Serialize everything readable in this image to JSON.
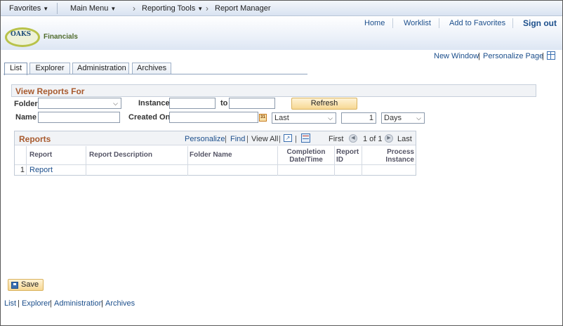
{
  "nav": {
    "favorites": "Favorites",
    "main_menu": "Main Menu",
    "reporting_tools": "Reporting Tools",
    "report_manager": "Report Manager"
  },
  "header": {
    "logo_text": "OAKS",
    "logo_sub": "Financials",
    "home": "Home",
    "worklist": "Worklist",
    "add_to_favorites": "Add to Favorites",
    "sign_out": "Sign out"
  },
  "page_links": {
    "new_window": "New Window",
    "personalize_page": "Personalize Page"
  },
  "tabs": [
    "List",
    "Explorer",
    "Administration",
    "Archives"
  ],
  "filters": {
    "section_title": "View Reports For",
    "folder_label": "Folder",
    "folder_value": "",
    "instance_label": "Instance",
    "instance_from": "",
    "to_label": "to",
    "instance_to": "",
    "refresh_label": "Refresh",
    "name_label": "Name",
    "name_value": "",
    "created_on_label": "Created On",
    "created_on_value": "",
    "calendar_glyph": "31",
    "period_value": "Last",
    "count_value": "1",
    "unit_value": "Days"
  },
  "reports_grid": {
    "title": "Reports",
    "personalize": "Personalize",
    "find": "Find",
    "view_all": "View All",
    "first": "First",
    "range": "1 of 1",
    "last": "Last",
    "columns": [
      "Report",
      "Report Description",
      "Folder Name",
      "Completion Date/Time",
      "Report ID",
      "Process Instance"
    ],
    "column_lines": {
      "completion": [
        "Completion",
        "Date/Time"
      ],
      "report_id": [
        "Report",
        "ID"
      ],
      "process_instance": [
        "Process",
        "Instance"
      ]
    },
    "rows": [
      {
        "num": "1",
        "report": "Report",
        "description": "",
        "folder": "",
        "completion": "",
        "report_id": "",
        "process_instance": ""
      }
    ]
  },
  "save_label": "Save",
  "bottom_links": [
    "List",
    "Explorer",
    "Administration",
    "Archives"
  ],
  "colors": {
    "accent_title": "#a85a2e",
    "link": "#1c4f8c",
    "button": "#f7d894"
  }
}
